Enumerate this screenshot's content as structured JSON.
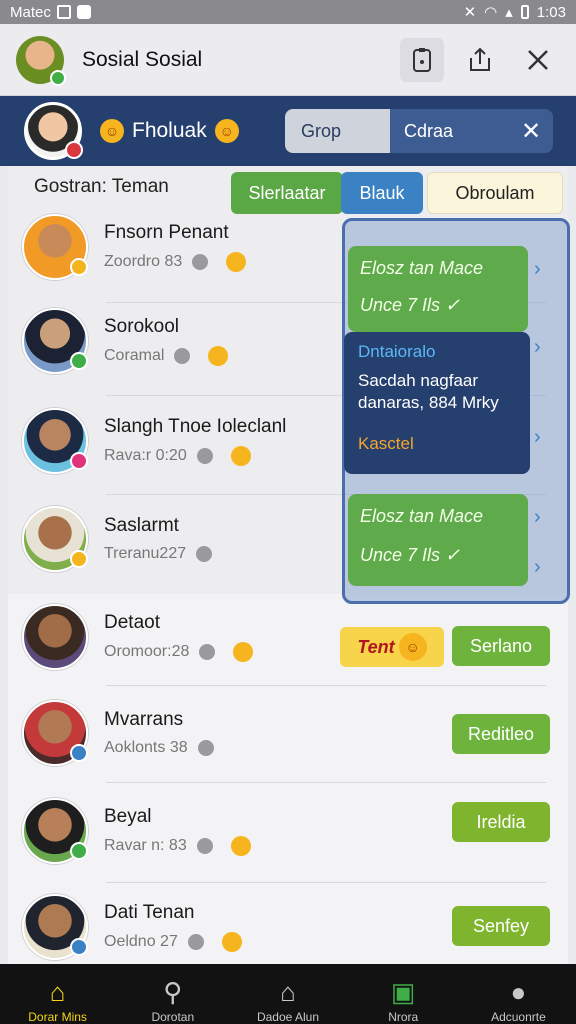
{
  "status_bar": {
    "left_text": "Matec",
    "time": "1:03"
  },
  "app_bar": {
    "title": "Sosial  Sosial"
  },
  "chat_header": {
    "name": "Fholuak",
    "search_group": "Grop",
    "search_current": "Cdraa"
  },
  "section_title": "Gostran: Teman",
  "filters": {
    "tab1": "Slerlaatar",
    "tab2": "Blauk",
    "tab3": "Obroulam"
  },
  "contacts": [
    {
      "name": "Fnsorn Penant",
      "sub": "Zoordro 83"
    },
    {
      "name": "Sorokool",
      "sub": "Coramal"
    },
    {
      "name": "Slangh Tnoe Ioleclanl",
      "sub": "Rava:r 0:20"
    },
    {
      "name": "Saslarmt",
      "sub": "Treranu227"
    },
    {
      "name": "Detaot",
      "sub": "Oromoor:28"
    },
    {
      "name": "Mvarrans",
      "sub": "Aoklonts 38"
    },
    {
      "name": "Beyal",
      "sub": "Ravar n: 83"
    },
    {
      "name": "Dati Tenan",
      "sub": "Oeldno 27"
    }
  ],
  "messages": {
    "green1_line1": "Elosz tan Mace",
    "green1_line2": "Unce 7 Ils ✓",
    "navy_title": "Dntaioralo",
    "navy_body": "Sacdah nagfaar danaras, 884 Mrky",
    "navy_footer": "Kasctel",
    "green2_line1": "Elosz tan Mace",
    "green2_line2": "Unce 7 Ils ✓"
  },
  "actions": {
    "tag": "Tent",
    "btn1": "Serlano",
    "btn2": "Reditleo",
    "btn3": "Ireldia",
    "btn4": "Senfey"
  },
  "bottom_nav": [
    "Dorar Mins",
    "Dorotan",
    "Dadoe Alun",
    "Nrora",
    "Adcuonrte"
  ]
}
